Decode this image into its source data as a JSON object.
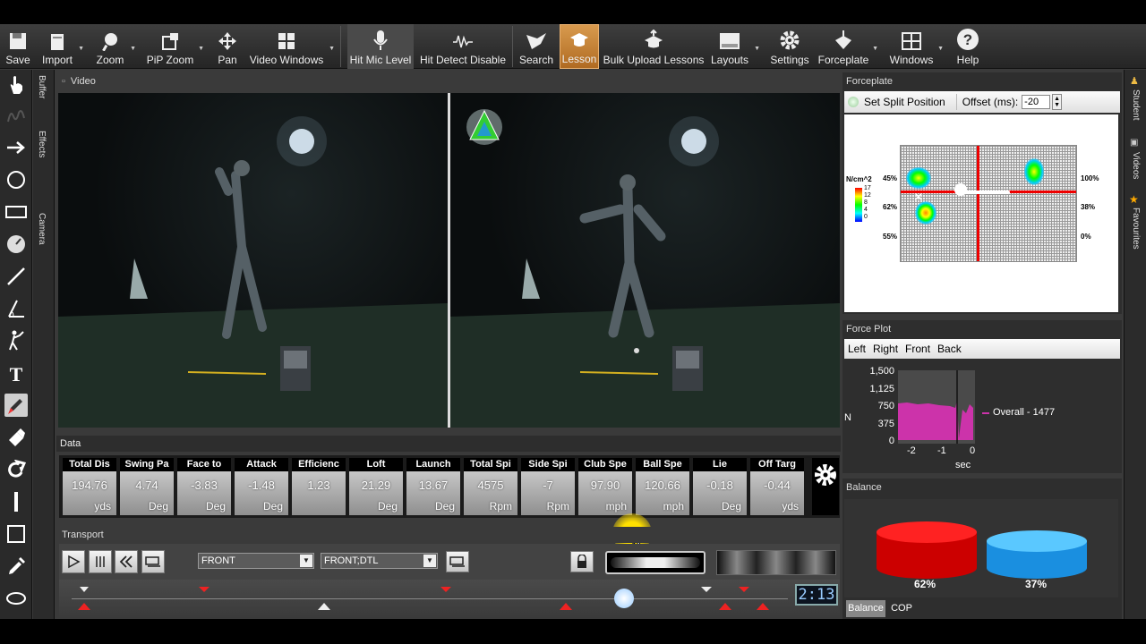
{
  "toolbar": {
    "items": [
      {
        "label": "Save",
        "icon": "save-icon"
      },
      {
        "label": "Import",
        "icon": "import-icon"
      },
      {
        "label": "Zoom",
        "icon": "zoom-icon"
      },
      {
        "label": "PiP Zoom",
        "icon": "pip-zoom-icon"
      },
      {
        "label": "Pan",
        "icon": "pan-icon"
      },
      {
        "label": "Video Windows",
        "icon": "video-windows-icon"
      },
      {
        "label": "Hit Mic Level",
        "icon": "microphone-icon"
      },
      {
        "label": "Hit Detect Disable",
        "icon": "hit-detect-icon"
      },
      {
        "label": "Search",
        "icon": "search-icon"
      },
      {
        "label": "Lesson",
        "icon": "lesson-icon"
      },
      {
        "label": "Bulk Upload Lessons",
        "icon": "bulk-upload-icon"
      },
      {
        "label": "Layouts",
        "icon": "layouts-icon"
      },
      {
        "label": "Settings",
        "icon": "gear-icon"
      },
      {
        "label": "Forceplate",
        "icon": "forceplate-icon"
      },
      {
        "label": "Windows",
        "icon": "windows-icon"
      },
      {
        "label": "Help",
        "icon": "help-icon"
      }
    ],
    "active_item": "Lesson",
    "accent": "#d08a3c"
  },
  "side_tabs": {
    "buffer": "Buffer",
    "effects": "Effects",
    "camera": "Camera"
  },
  "right_tabs": {
    "student": "Student",
    "videos": "Videos",
    "favourites": "Favourites"
  },
  "video": {
    "header": "Video"
  },
  "data": {
    "header": "Data",
    "metrics": [
      {
        "name": "Total Dis",
        "value": "194.76",
        "unit": "yds"
      },
      {
        "name": "Swing Pa",
        "value": "4.74",
        "unit": "Deg"
      },
      {
        "name": "Face to",
        "value": "-3.83",
        "unit": "Deg"
      },
      {
        "name": "Attack",
        "value": "-1.48",
        "unit": "Deg"
      },
      {
        "name": "Efficienc",
        "value": "1.23",
        "unit": ""
      },
      {
        "name": "Loft",
        "value": "21.29",
        "unit": "Deg"
      },
      {
        "name": "Launch",
        "value": "13.67",
        "unit": "Deg"
      },
      {
        "name": "Total Spi",
        "value": "4575",
        "unit": "Rpm"
      },
      {
        "name": "Side Spi",
        "value": "-7",
        "unit": "Rpm"
      },
      {
        "name": "Club Spe",
        "value": "97.90",
        "unit": "mph"
      },
      {
        "name": "Ball Spe",
        "value": "120.66",
        "unit": "mph"
      },
      {
        "name": "Lie",
        "value": "-0.18",
        "unit": "Deg"
      },
      {
        "name": "Off Targ",
        "value": "-0.44",
        "unit": "yds"
      }
    ]
  },
  "transport": {
    "header": "Transport",
    "view1": "FRONT",
    "view2": "FRONT;DTL",
    "frame_display": "2:13"
  },
  "forceplate": {
    "header": "Forceplate",
    "split_button": "Set Split Position",
    "offset_label": "Offset (ms):",
    "offset_value": "-20",
    "legend_unit": "N/cm^2",
    "legend_values": [
      "17",
      "12",
      "8",
      "4",
      "0"
    ],
    "left_pcts": [
      "45%",
      "62%",
      "55%"
    ],
    "right_pcts": [
      "100%",
      "38%",
      "0%"
    ]
  },
  "force_plot": {
    "header": "Force Plot",
    "tabs": [
      "Left",
      "Right",
      "Front",
      "Back"
    ],
    "y_ticks": [
      "1,500",
      "1,125",
      "750",
      "375",
      "0"
    ],
    "y_label": "N",
    "x_ticks": [
      "-2",
      "-1",
      "0"
    ],
    "x_label": "sec",
    "legend": "Overall - 1477",
    "series_color": "#cc33aa"
  },
  "balance": {
    "header": "Balance",
    "left_pct": "62%",
    "right_pct": "37%",
    "left_color": "#e01010",
    "right_color": "#2aa8f0",
    "tabs": [
      "Balance",
      "COP"
    ]
  }
}
